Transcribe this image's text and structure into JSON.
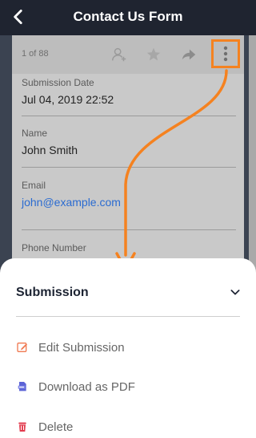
{
  "header": {
    "title": "Contact Us Form"
  },
  "card": {
    "counter": "1 of 88",
    "fields": [
      {
        "label": "Submission Date",
        "value": "Jul 04, 2019 22:52"
      },
      {
        "label": "Name",
        "value": "John Smith"
      },
      {
        "label": "Email",
        "value": "john@example.com"
      },
      {
        "label": "Phone Number",
        "value": ""
      }
    ]
  },
  "sheet": {
    "title": "Submission",
    "actions": [
      {
        "label": "Edit Submission",
        "icon": "edit-icon",
        "color": "#f07a52"
      },
      {
        "label": "Download as PDF",
        "icon": "pdf-icon",
        "color": "#5b63d6"
      },
      {
        "label": "Delete",
        "icon": "trash-icon",
        "color": "#e23a4d"
      }
    ]
  },
  "colors": {
    "topbar": "#1f2430",
    "highlight": "#f58220",
    "link": "#2a6bd1"
  }
}
